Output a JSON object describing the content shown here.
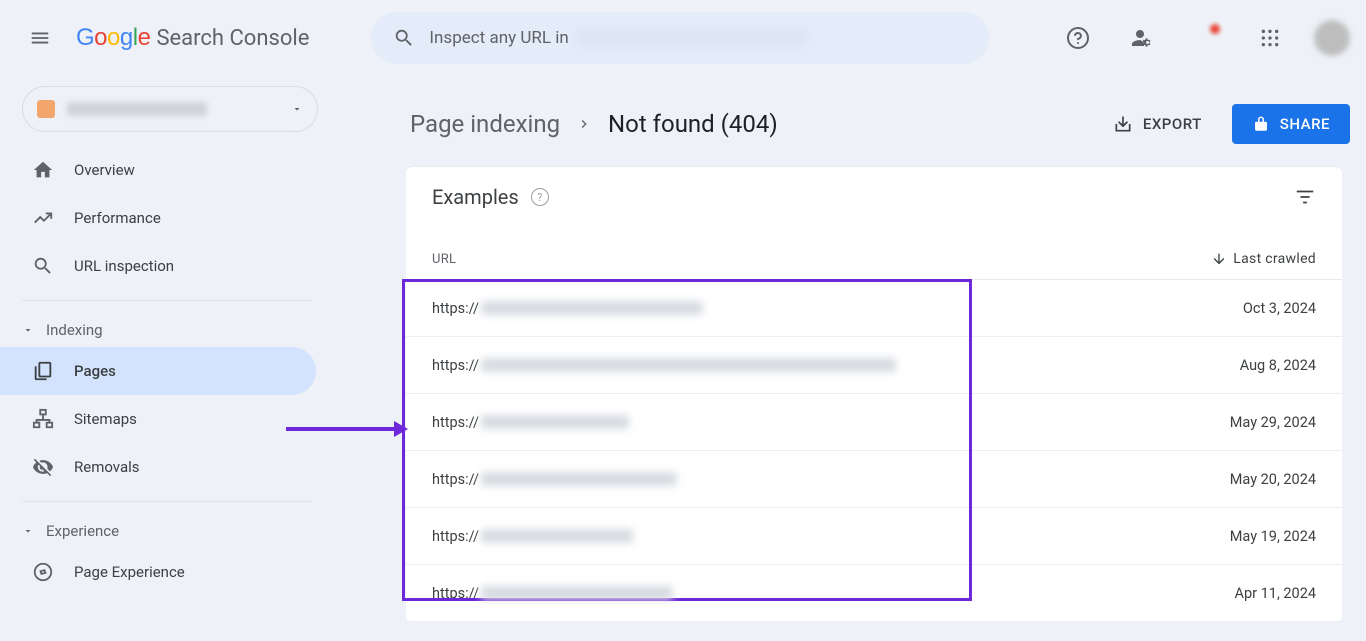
{
  "header": {
    "logo_text": "Search Console",
    "search_placeholder_prefix": "Inspect any URL in"
  },
  "sidebar": {
    "nav_overview": "Overview",
    "nav_performance": "Performance",
    "nav_url_inspection": "URL inspection",
    "section_indexing": "Indexing",
    "nav_pages": "Pages",
    "nav_sitemaps": "Sitemaps",
    "nav_removals": "Removals",
    "section_experience": "Experience",
    "nav_page_experience": "Page Experience"
  },
  "breadcrumb": {
    "parent": "Page indexing",
    "current": "Not found (404)",
    "export": "EXPORT",
    "share": "SHARE"
  },
  "card": {
    "title": "Examples",
    "columns": {
      "url": "URL",
      "last_crawled": "Last crawled"
    }
  },
  "url_prefix": "https://",
  "rows": [
    {
      "blur_w": 222,
      "date": "Oct 3, 2024"
    },
    {
      "blur_w": 415,
      "date": "Aug 8, 2024"
    },
    {
      "blur_w": 148,
      "date": "May 29, 2024"
    },
    {
      "blur_w": 196,
      "date": "May 20, 2024"
    },
    {
      "blur_w": 152,
      "date": "May 19, 2024"
    },
    {
      "blur_w": 192,
      "date": "Apr 11, 2024"
    }
  ]
}
